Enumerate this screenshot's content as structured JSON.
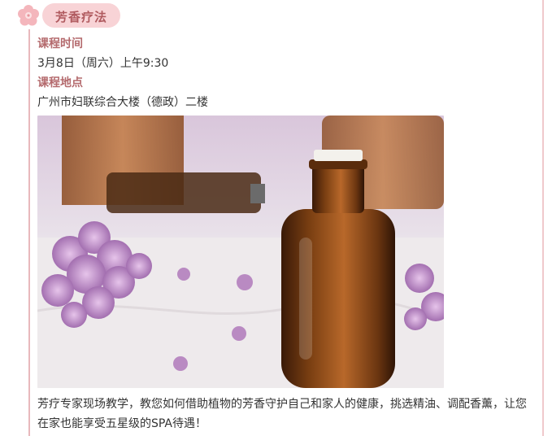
{
  "section": {
    "title": "芳香疗法",
    "icon": "flower-icon"
  },
  "schedule": {
    "time_label": "课程时间",
    "time_value": "3月8日（周六）上午9:30",
    "place_label": "课程地点",
    "place_value": "广州市妇联综合大楼（德政）二楼"
  },
  "photo": {
    "subject": "amber essential oil bottle with lilac flowers"
  },
  "description": "芳疗专家现场教学，教您如何借助植物的芳香守护自己和家人的健康，挑选精油、调配香薰，让您在家也能享受五星级的SPA待遇！",
  "colors": {
    "accent": "#b46a6d",
    "badge_bg": "#f8d3d6",
    "rule": "#e8b8bc"
  }
}
